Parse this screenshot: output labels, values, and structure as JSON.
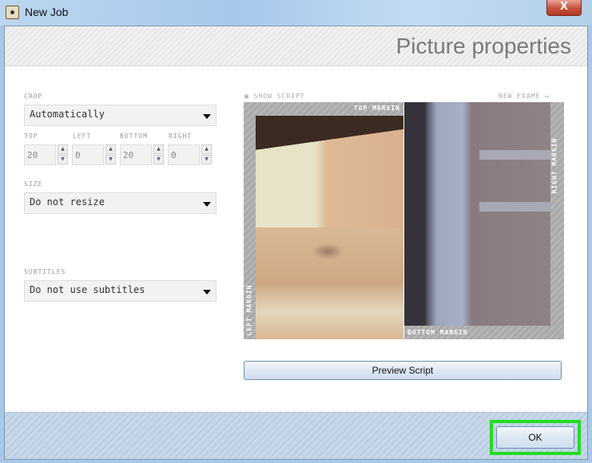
{
  "window": {
    "title": "New Job",
    "close_label": "X"
  },
  "header": {
    "title": "Picture properties"
  },
  "crop": {
    "label": "CROP",
    "value": "Automatically",
    "fields": [
      {
        "label": "TOP",
        "value": "20"
      },
      {
        "label": "LEFT",
        "value": "0"
      },
      {
        "label": "BOTTOM",
        "value": "20"
      },
      {
        "label": "RIGHT",
        "value": "0"
      }
    ]
  },
  "size": {
    "label": "SIZE",
    "value": "Do not resize"
  },
  "subtitles": {
    "label": "SUBTITLES",
    "value": "Do not use subtitles"
  },
  "preview": {
    "show_script": "SHOW SCRIPT",
    "new_frame": "NEW FRAME",
    "top_margin": "TOP MARGIN",
    "left_margin": "LEFT MARGIN",
    "right_margin": "RIGHT MARGIN",
    "bottom_margin": "BOTTOM MARGIN",
    "button": "Preview Script"
  },
  "footer": {
    "ok": "OK"
  },
  "colors": {
    "highlight": "#22dd22"
  }
}
